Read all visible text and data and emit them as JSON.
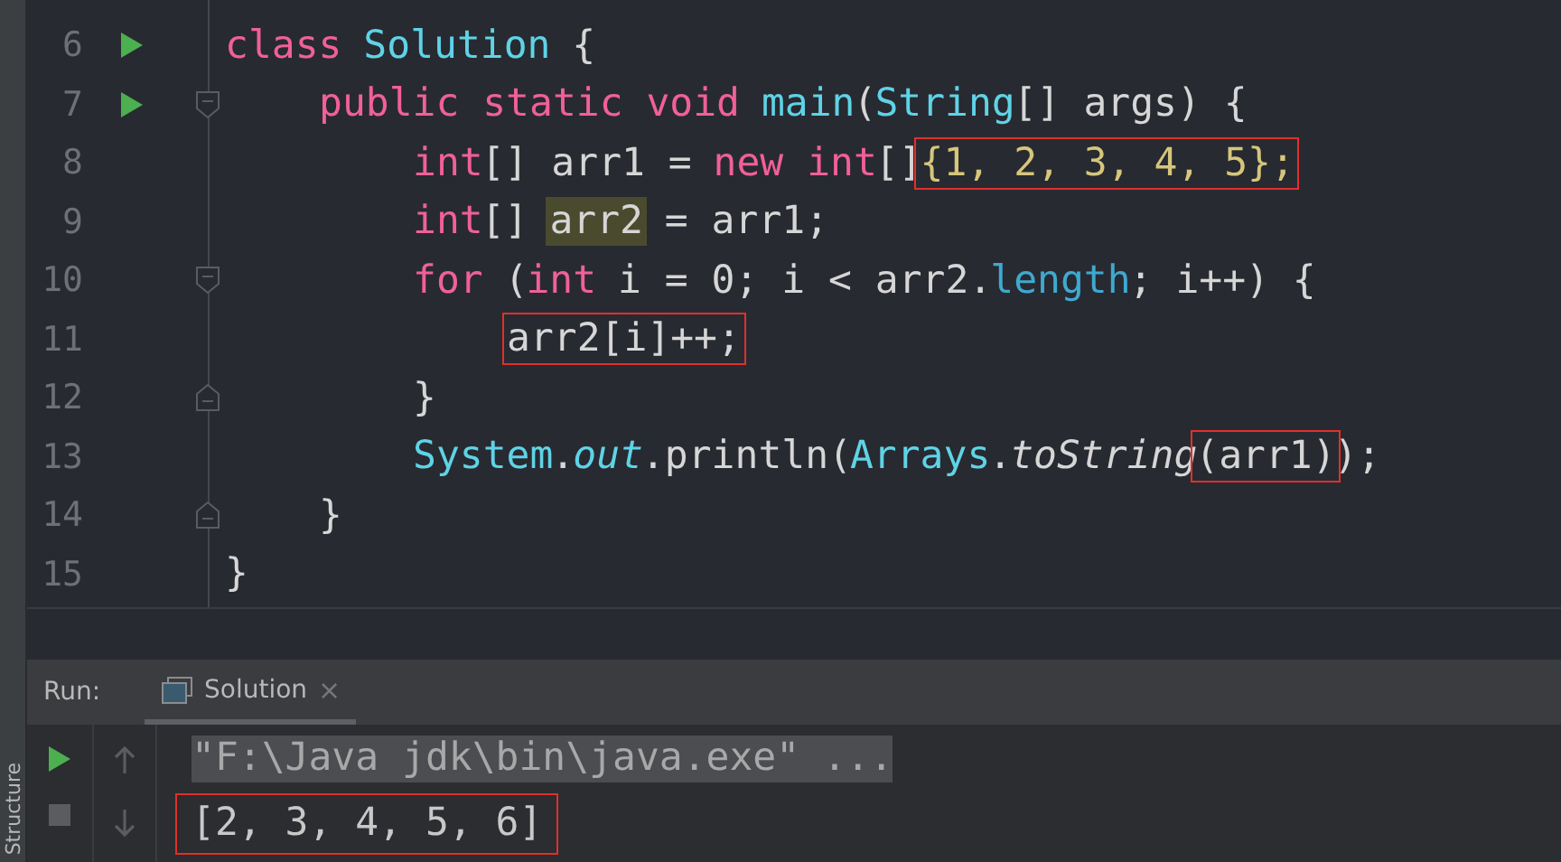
{
  "editor": {
    "lines": [
      {
        "number": "6",
        "run": true,
        "fold_start": false,
        "fold_end": false,
        "tokens": [
          {
            "kind": "kw",
            "text": "class"
          },
          {
            "kind": "cls",
            "text": " Solution"
          },
          {
            "kind": "plain",
            "text": " {"
          }
        ],
        "children": [
          {
            "number": "7",
            "run": true,
            "fold_start": true,
            "fold_end": false,
            "tokens": [
              {
                "kind": "kw",
                "text": "public static void"
              },
              {
                "kind": "cls",
                "text": " main"
              },
              {
                "kind": "plain",
                "text": "("
              },
              {
                "kind": "cls",
                "text": "String"
              },
              {
                "kind": "plain",
                "text": "[] args) {"
              }
            ],
            "children": [
              {
                "number": "8",
                "run": false,
                "fold_start": false,
                "fold_end": false,
                "tokens": [
                  {
                    "kind": "kw",
                    "text": "int"
                  },
                  {
                    "kind": "plain",
                    "text": "[] arr1 = "
                  },
                  {
                    "kind": "kw",
                    "text": "new int"
                  },
                  {
                    "kind": "plain",
                    "text": "[]"
                  },
                  {
                    "kind": "num",
                    "text": "{1, 2, 3, 4, 5};",
                    "boxed": true
                  }
                ]
              },
              {
                "number": "9",
                "run": false,
                "fold_start": false,
                "fold_end": false,
                "tokens": [
                  {
                    "kind": "kw",
                    "text": "int"
                  },
                  {
                    "kind": "plain",
                    "text": "[] "
                  },
                  {
                    "kind": "hl",
                    "text": "arr2"
                  },
                  {
                    "kind": "plain",
                    "text": " = arr1;"
                  }
                ]
              },
              {
                "number": "10",
                "run": false,
                "fold_start": true,
                "fold_end": false,
                "tokens": [
                  {
                    "kind": "kw",
                    "text": "for"
                  },
                  {
                    "kind": "plain",
                    "text": " ("
                  },
                  {
                    "kind": "kw",
                    "text": "int"
                  },
                  {
                    "kind": "plain",
                    "text": " i = 0; i < arr2."
                  },
                  {
                    "kind": "field",
                    "text": "length"
                  },
                  {
                    "kind": "plain",
                    "text": "; i++) {"
                  }
                ],
                "children": [
                  {
                    "number": "11",
                    "run": false,
                    "fold_start": false,
                    "fold_end": false,
                    "tokens": [
                      {
                        "kind": "plain",
                        "text": "arr2[i]++;",
                        "boxed": true
                      }
                    ]
                  }
                ]
              },
              {
                "number": "12",
                "run": false,
                "fold_start": false,
                "fold_end": true,
                "tokens": [
                  {
                    "kind": "plain",
                    "text": "}"
                  }
                ]
              },
              {
                "number": "13",
                "run": false,
                "fold_start": false,
                "fold_end": false,
                "tokens": [
                  {
                    "kind": "cls",
                    "text": "System"
                  },
                  {
                    "kind": "plain",
                    "text": "."
                  },
                  {
                    "kind": "static",
                    "text": "out"
                  },
                  {
                    "kind": "plain",
                    "text": ".println("
                  },
                  {
                    "kind": "cls",
                    "text": "Arrays"
                  },
                  {
                    "kind": "plain",
                    "text": "."
                  },
                  {
                    "kind": "italic",
                    "text": "toString"
                  },
                  {
                    "kind": "plain",
                    "text": "(arr1)",
                    "boxed": true
                  },
                  {
                    "kind": "plain",
                    "text": ");"
                  }
                ]
              }
            ]
          },
          {
            "number": "14",
            "run": false,
            "fold_start": false,
            "fold_end": true,
            "tokens": [
              {
                "kind": "plain",
                "text": "}"
              }
            ]
          }
        ]
      },
      {
        "number": "15",
        "run": false,
        "fold_start": false,
        "fold_end": false,
        "tokens": [
          {
            "kind": "plain",
            "text": "}"
          }
        ]
      }
    ]
  },
  "side_strip": {
    "label": "Structure"
  },
  "run_panel": {
    "label": "Run:",
    "tabs": [
      {
        "label": "Solution",
        "selected": true,
        "close": "×"
      }
    ],
    "console": [
      {
        "kind": "command",
        "text": "\"F:\\Java jdk\\bin\\java.exe\" ...",
        "boxed": false
      },
      {
        "kind": "output",
        "text": "[2, 3, 4, 5, 6]",
        "boxed": true
      }
    ]
  }
}
